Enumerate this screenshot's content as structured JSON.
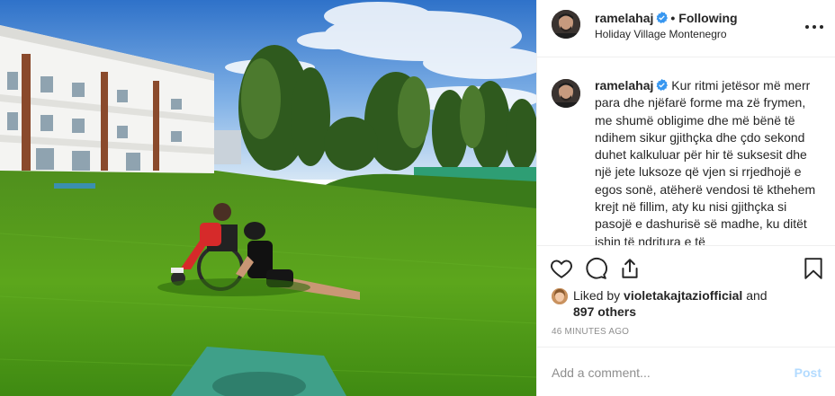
{
  "header": {
    "username": "ramelahaj",
    "separator": "•",
    "follow_label": "Following",
    "location": "Holiday Village Montenegro"
  },
  "caption": {
    "username": "ramelahaj",
    "text": "Kur ritmi jetësor më merr para dhe njëfarë forme ma zë frymen, me shumë obligime dhe më bënë të ndihem sikur gjithçka dhe çdo sekond duhet kalkuluar për hir të suksesit dhe një jete luksoze që vjen si rrjedhojë e egos sonë, atëherë vendosi të kthehem krejt në fillim, aty ku nisi gjithçka si pasojë e dashurisë së madhe, ku ditët ishin të ndritura e të"
  },
  "actions": {
    "like_icon": "heart-icon",
    "comment_icon": "comment-bubble-icon",
    "share_icon": "share-icon",
    "save_icon": "bookmark-icon"
  },
  "likes": {
    "prefix": "Liked by",
    "user": "violetakajtaziofficial",
    "and": "and",
    "others": "897 others"
  },
  "timestamp": "46 minutes ago",
  "comment_box": {
    "placeholder": "Add a comment...",
    "post_label": "Post"
  },
  "colors": {
    "verified": "#3897f0",
    "text": "#262626",
    "muted": "#8e8e8e",
    "post_disabled": "#b3dbff",
    "divider": "#efefef"
  }
}
